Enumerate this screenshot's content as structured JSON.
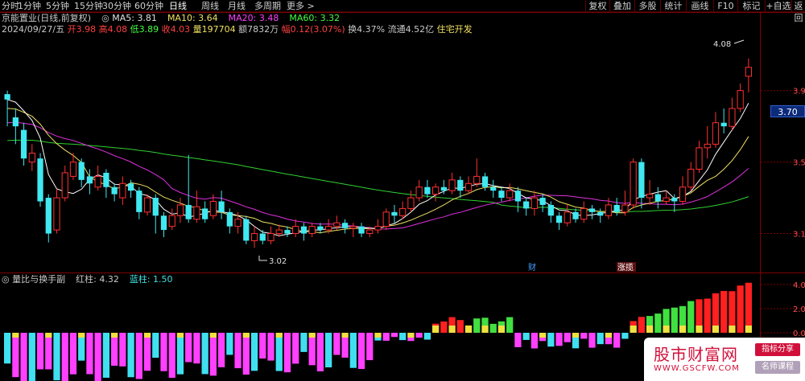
{
  "toolbar": {
    "timeframes": [
      {
        "label": "分时",
        "active": false
      },
      {
        "label": "1分钟",
        "active": false
      },
      {
        "label": "5分钟",
        "active": false
      },
      {
        "label": "15分钟",
        "active": false
      },
      {
        "label": "30分钟",
        "active": false
      },
      {
        "label": "60分钟",
        "active": false
      },
      {
        "label": "日线",
        "active": true
      },
      {
        "label": "周线",
        "active": false
      },
      {
        "label": "月线",
        "active": false
      },
      {
        "label": "多周期",
        "active": false
      },
      {
        "label": "更多 >",
        "active": false
      }
    ],
    "buttons": [
      "复权",
      "叠加",
      "多股",
      "统计",
      "画线",
      "F10",
      "标记",
      "+自选",
      "返回"
    ]
  },
  "header": {
    "stock_title": "京能置业(日线,前复权)",
    "ma5_label": "MA5:",
    "ma5": "3.81",
    "ma10_label": "MA10:",
    "ma10": "3.64",
    "ma20_label": "MA20:",
    "ma20": "3.48",
    "ma60_label": "MA60:",
    "ma60": "3.32",
    "date": "2024/09/27/五",
    "open_label": "开",
    "open": "3.98",
    "high_label": "高",
    "high": "4.08",
    "low_label": "低",
    "low": "3.89",
    "close_label": "收",
    "close": "4.03",
    "vol_label": "量",
    "vol": "197704",
    "amount_label": "额",
    "amount": "7832万",
    "change_label": "幅",
    "change": "0.12(3.07%)",
    "turnover_label": "换",
    "turnover": "4.37%",
    "float_label": "流通",
    "float": "4.52亿",
    "sector": "住宅开发"
  },
  "price_axis": {
    "labels": [
      "3.9",
      "3.5",
      "3.1"
    ],
    "current": "3.70"
  },
  "annotations": {
    "high": "4.08",
    "low": "3.02",
    "mark1": "财",
    "mark2": "涨揽"
  },
  "indicator": {
    "name": "量比与换手副",
    "red_label": "红柱:",
    "red_value": "4.32",
    "blue_label": "蓝柱:",
    "blue_value": "1.50",
    "axis_labels": [
      "4.0",
      "2.0",
      "0.0"
    ]
  },
  "watermark": {
    "title": "股市财富网",
    "url": "WWW.GSCFW.COM",
    "badge1": "指标分享",
    "badge2": "名师课程"
  },
  "colors": {
    "up": "#ff3030",
    "down": "#40e8f0",
    "ma5": "#ffffff",
    "ma10": "#f0e060",
    "ma20": "#e030e0",
    "ma60": "#30d030"
  },
  "chart_data": {
    "type": "candlestick",
    "price_range": [
      2.9,
      4.2
    ],
    "candles": [
      [
        3.88,
        3.85,
        3.9,
        3.7
      ],
      [
        3.75,
        3.7,
        3.8,
        3.6
      ],
      [
        3.68,
        3.52,
        3.72,
        3.48
      ],
      [
        3.5,
        3.55,
        3.6,
        3.45
      ],
      [
        3.52,
        3.28,
        3.55,
        3.25
      ],
      [
        3.3,
        3.1,
        3.32,
        3.05
      ],
      [
        3.12,
        3.3,
        3.35,
        3.1
      ],
      [
        3.3,
        3.44,
        3.48,
        3.28
      ],
      [
        3.42,
        3.5,
        3.55,
        3.4
      ],
      [
        3.5,
        3.4,
        3.52,
        3.36
      ],
      [
        3.42,
        3.38,
        3.46,
        3.32
      ],
      [
        3.36,
        3.42,
        3.48,
        3.34
      ],
      [
        3.44,
        3.36,
        3.46,
        3.3
      ],
      [
        3.36,
        3.32,
        3.38,
        3.28
      ],
      [
        3.3,
        3.38,
        3.42,
        3.26
      ],
      [
        3.38,
        3.34,
        3.4,
        3.3
      ],
      [
        3.34,
        3.22,
        3.36,
        3.18
      ],
      [
        3.22,
        3.3,
        3.32,
        3.2
      ],
      [
        3.3,
        3.2,
        3.32,
        3.1
      ],
      [
        3.2,
        3.12,
        3.22,
        3.08
      ],
      [
        3.14,
        3.2,
        3.24,
        3.12
      ],
      [
        3.2,
        3.26,
        3.3,
        3.16
      ],
      [
        3.26,
        3.18,
        3.54,
        3.16
      ],
      [
        3.18,
        3.25,
        3.34,
        3.16
      ],
      [
        3.24,
        3.18,
        3.28,
        3.16
      ],
      [
        3.2,
        3.28,
        3.32,
        3.18
      ],
      [
        3.28,
        3.22,
        3.34,
        3.18
      ],
      [
        3.22,
        3.14,
        3.24,
        3.1
      ],
      [
        3.14,
        3.18,
        3.22,
        3.1
      ],
      [
        3.18,
        3.06,
        3.2,
        3.04
      ],
      [
        3.06,
        3.1,
        3.14,
        3.02
      ],
      [
        3.1,
        3.06,
        3.12,
        3.04
      ],
      [
        3.06,
        3.1,
        3.14,
        3.04
      ],
      [
        3.1,
        3.12,
        3.15,
        3.08
      ],
      [
        3.12,
        3.1,
        3.14,
        3.08
      ],
      [
        3.1,
        3.14,
        3.18,
        3.08
      ],
      [
        3.14,
        3.1,
        3.16,
        3.06
      ],
      [
        3.1,
        3.14,
        3.16,
        3.08
      ],
      [
        3.14,
        3.12,
        3.16,
        3.1
      ],
      [
        3.12,
        3.14,
        3.18,
        3.1
      ],
      [
        3.14,
        3.16,
        3.2,
        3.12
      ],
      [
        3.16,
        3.13,
        3.18,
        3.1
      ],
      [
        3.13,
        3.14,
        3.16,
        3.08
      ],
      [
        3.14,
        3.1,
        3.16,
        3.08
      ],
      [
        3.1,
        3.12,
        3.14,
        3.08
      ],
      [
        3.12,
        3.14,
        3.18,
        3.1
      ],
      [
        3.14,
        3.22,
        3.24,
        3.12
      ],
      [
        3.22,
        3.2,
        3.26,
        3.16
      ],
      [
        3.2,
        3.24,
        3.28,
        3.18
      ],
      [
        3.24,
        3.3,
        3.34,
        3.22
      ],
      [
        3.3,
        3.36,
        3.4,
        3.28
      ],
      [
        3.36,
        3.32,
        3.4,
        3.3
      ],
      [
        3.32,
        3.36,
        3.38,
        3.28
      ],
      [
        3.36,
        3.34,
        3.4,
        3.32
      ],
      [
        3.34,
        3.4,
        3.44,
        3.32
      ],
      [
        3.4,
        3.34,
        3.42,
        3.3
      ],
      [
        3.34,
        3.38,
        3.42,
        3.32
      ],
      [
        3.38,
        3.42,
        3.52,
        3.36
      ],
      [
        3.42,
        3.36,
        3.44,
        3.34
      ],
      [
        3.36,
        3.34,
        3.4,
        3.3
      ],
      [
        3.34,
        3.3,
        3.36,
        3.28
      ],
      [
        3.3,
        3.34,
        3.38,
        3.28
      ],
      [
        3.34,
        3.28,
        3.36,
        3.22
      ],
      [
        3.28,
        3.24,
        3.3,
        3.2
      ],
      [
        3.24,
        3.3,
        3.34,
        3.2
      ],
      [
        3.3,
        3.26,
        3.32,
        3.22
      ],
      [
        3.26,
        3.2,
        3.28,
        3.16
      ],
      [
        3.2,
        3.16,
        3.22,
        3.12
      ],
      [
        3.16,
        3.22,
        3.26,
        3.14
      ],
      [
        3.22,
        3.18,
        3.24,
        3.16
      ],
      [
        3.18,
        3.24,
        3.28,
        3.16
      ],
      [
        3.24,
        3.22,
        3.26,
        3.18
      ],
      [
        3.22,
        3.2,
        3.24,
        3.16
      ],
      [
        3.2,
        3.26,
        3.3,
        3.18
      ],
      [
        3.26,
        3.22,
        3.3,
        3.2
      ],
      [
        3.22,
        3.26,
        3.34,
        3.2
      ],
      [
        3.26,
        3.5,
        3.52,
        3.24
      ],
      [
        3.5,
        3.3,
        3.52,
        3.24
      ],
      [
        3.3,
        3.32,
        3.4,
        3.26
      ],
      [
        3.32,
        3.28,
        3.36,
        3.24
      ],
      [
        3.28,
        3.3,
        3.34,
        3.26
      ],
      [
        3.3,
        3.28,
        3.32,
        3.22
      ],
      [
        3.28,
        3.36,
        3.42,
        3.26
      ],
      [
        3.36,
        3.46,
        3.5,
        3.34
      ],
      [
        3.46,
        3.58,
        3.62,
        3.44
      ],
      [
        3.58,
        3.6,
        3.7,
        3.52
      ],
      [
        3.6,
        3.72,
        3.78,
        3.58
      ],
      [
        3.72,
        3.7,
        3.8,
        3.66
      ],
      [
        3.7,
        3.8,
        3.86,
        3.68
      ],
      [
        3.8,
        3.9,
        3.94,
        3.78
      ],
      [
        3.98,
        4.03,
        4.08,
        3.89
      ]
    ],
    "ma": {
      "MA5": "3.81",
      "MA10": "3.64",
      "MA20": "3.48",
      "MA60": "3.32"
    },
    "indicator_red": [
      4.32
    ],
    "indicator_blue": [
      1.5
    ]
  }
}
